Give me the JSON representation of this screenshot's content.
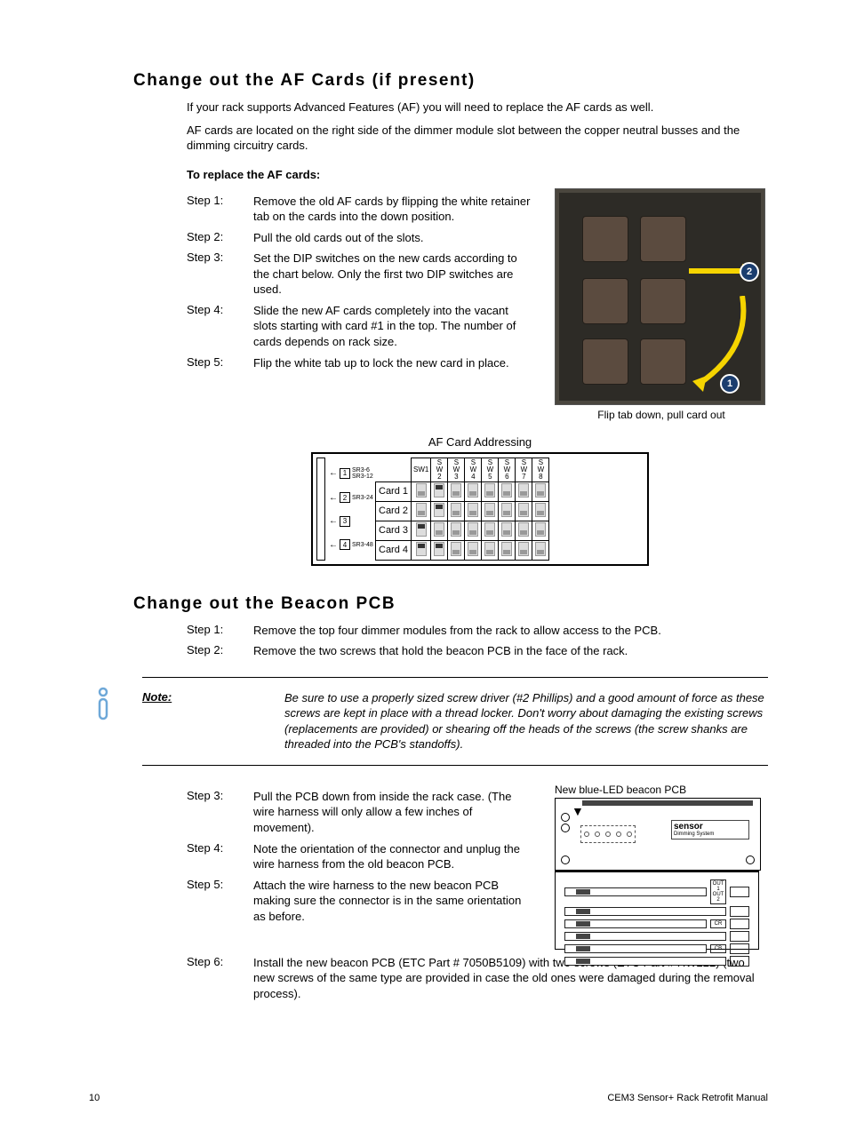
{
  "section1": {
    "title": "Change out the AF Cards (if present)",
    "intro1": "If your rack supports Advanced Features (AF) you will need to replace the AF cards as well.",
    "intro2": "AF cards are located on the right side of the dimmer module slot between the copper neutral busses and the dimming circuitry cards.",
    "sub": "To replace the AF cards:",
    "steps": [
      {
        "label": "Step 1:",
        "text": "Remove the old AF cards by flipping the white retainer tab on the cards into the down position."
      },
      {
        "label": "Step 2:",
        "text": "Pull the old cards out of the slots."
      },
      {
        "label": "Step 3:",
        "text": "Set the DIP switches on the new cards according to the chart below. Only the first two DIP switches are used."
      },
      {
        "label": "Step 4:",
        "text": "Slide the new AF cards completely into the vacant slots starting with card #1 in the top. The number of cards depends on rack size."
      },
      {
        "label": "Step 5:",
        "text": "Flip the white tab up to lock the new card in place."
      }
    ],
    "photo_caption": "Flip tab down, pull card out",
    "callouts": {
      "c1": "1",
      "c2": "2"
    },
    "af_table": {
      "title": "AF Card Addressing",
      "sw_headers": [
        "SW1",
        "SW2",
        "SW3",
        "SW4",
        "SW5",
        "SW6",
        "SW7",
        "SW8"
      ],
      "rows": [
        {
          "card": "Card 1",
          "sw": [
            "Off",
            "On",
            "off",
            "off",
            "off",
            "off",
            "off",
            "off"
          ]
        },
        {
          "card": "Card 2",
          "sw": [
            "Off",
            "On",
            "off",
            "off",
            "off",
            "off",
            "off",
            "off"
          ]
        },
        {
          "card": "Card 3",
          "sw": [
            "On",
            "off",
            "off",
            "off",
            "off",
            "off",
            "off",
            "off"
          ]
        },
        {
          "card": "Card 4",
          "sw": [
            "On",
            "On",
            "off",
            "off",
            "off",
            "off",
            "off",
            "off"
          ]
        }
      ],
      "left_labels": [
        {
          "num": "1",
          "model": "SR3-6\nSR3-12"
        },
        {
          "num": "2",
          "model": "SR3-24"
        },
        {
          "num": "3",
          "model": ""
        },
        {
          "num": "4",
          "model": "SR3-48"
        }
      ]
    }
  },
  "section2": {
    "title": "Change out the Beacon PCB",
    "stepsA": [
      {
        "label": "Step 1:",
        "text": "Remove the top four dimmer modules from the rack to allow access to the PCB."
      },
      {
        "label": "Step 2:",
        "text": "Remove the two screws that hold the beacon PCB in the face of the rack."
      }
    ],
    "note": {
      "label": "Note:",
      "text": "Be sure to use a properly sized screw driver (#2 Phillips) and a good amount of force as these screws are kept in place with a thread locker. Don't worry about damaging the existing screws (replacements are provided) or shearing off the heads of the screws (the screw shanks are threaded into the PCB's standoffs)."
    },
    "stepsB": [
      {
        "label": "Step 3:",
        "text": "Pull the PCB down from inside the rack case. (The wire harness will only allow a few inches of movement)."
      },
      {
        "label": "Step 4:",
        "text": "Note the orientation of the connector and unplug the wire harness from the old beacon PCB."
      },
      {
        "label": "Step 5:",
        "text": "Attach the wire harness to the new beacon PCB making sure the connector is in the same orientation as before."
      }
    ],
    "step6": {
      "label": "Step 6:",
      "text": "Install the new beacon PCB (ETC Part # 7050B5109) with two screws (ETC Part # HW222) (two new screws of the same type are provided in case the old ones were damaged during the removal process)."
    },
    "pcb_label": "New blue-LED beacon PCB",
    "pcb_logo_big": "sensor",
    "pcb_logo_small": "Dimming System"
  },
  "footer": {
    "page": "10",
    "title": "CEM3 Sensor+ Rack Retrofit Manual"
  },
  "chart_data": {
    "type": "table",
    "title": "AF Card Addressing",
    "description": "DIP switch settings for AF Cards 1-4. Only SW1 and SW2 are used; SW3-8 are unused/off.",
    "columns": [
      "Card",
      "SW1",
      "SW2",
      "SW3",
      "SW4",
      "SW5",
      "SW6",
      "SW7",
      "SW8"
    ],
    "rows": [
      [
        "Card 1",
        "Off",
        "On",
        "-",
        "-",
        "-",
        "-",
        "-",
        "-"
      ],
      [
        "Card 2",
        "Off",
        "On",
        "-",
        "-",
        "-",
        "-",
        "-",
        "-"
      ],
      [
        "Card 3",
        "On",
        "Off",
        "-",
        "-",
        "-",
        "-",
        "-",
        "-"
      ],
      [
        "Card 4",
        "On",
        "On",
        "-",
        "-",
        "-",
        "-",
        "-",
        "-"
      ]
    ],
    "rack_mapping": [
      {
        "card": 1,
        "racks": [
          "SR3-6",
          "SR3-12"
        ]
      },
      {
        "card": 2,
        "racks": [
          "SR3-24"
        ]
      },
      {
        "card": 3,
        "racks": []
      },
      {
        "card": 4,
        "racks": [
          "SR3-48"
        ]
      }
    ]
  }
}
